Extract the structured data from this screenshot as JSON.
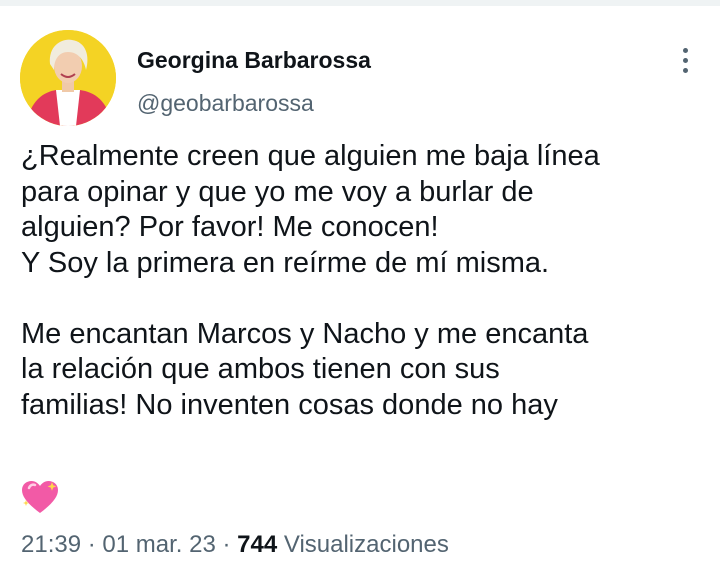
{
  "tweet": {
    "author": {
      "display_name": "Georgina Barbarossa",
      "handle": "@geobarbarossa"
    },
    "text": "¿Realmente creen que alguien me baja línea\npara opinar y que yo me voy a burlar de\nalguien? Por favor! Me conocen!\nY Soy la primera en reírme de mí misma.\n\nMe encantan Marcos y Nacho y me encanta\nla relación que ambos tienen con sus\nfamilias! No inventen cosas donde no hay",
    "emoji_icon": "sparkling-heart-icon",
    "meta": {
      "time": "21:39",
      "separator": "·",
      "date": "01 mar. 23",
      "views_count": "744",
      "views_label": "Visualizaciones"
    }
  },
  "colors": {
    "text_primary": "#0f1419",
    "text_secondary": "#536471",
    "divider": "#eff3f4",
    "emoji_pink": "#f25aa6"
  }
}
